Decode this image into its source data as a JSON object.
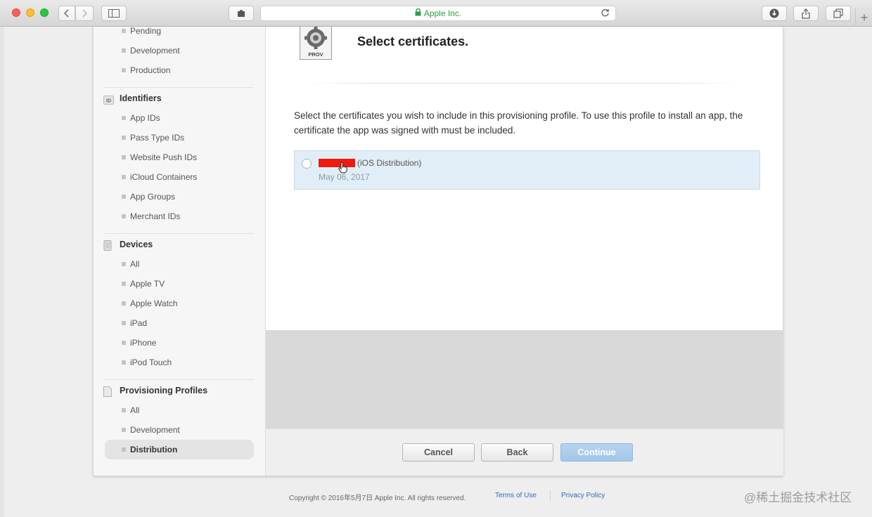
{
  "browser": {
    "url_display": "Apple Inc.",
    "new_tab_label": "+"
  },
  "sidebar": {
    "top_items": [
      "Pending",
      "Development",
      "Production"
    ],
    "sections": [
      {
        "title": "Identifiers",
        "icon": "id-icon",
        "items": [
          "App IDs",
          "Pass Type IDs",
          "Website Push IDs",
          "iCloud Containers",
          "App Groups",
          "Merchant IDs"
        ]
      },
      {
        "title": "Devices",
        "icon": "device-icon",
        "items": [
          "All",
          "Apple TV",
          "Apple Watch",
          "iPad",
          "iPhone",
          "iPod Touch"
        ]
      },
      {
        "title": "Provisioning Profiles",
        "icon": "document-icon",
        "items": [
          "All",
          "Development",
          "Distribution"
        ],
        "active": "Distribution"
      }
    ],
    "id_badge": "ID"
  },
  "main": {
    "prov_icon_label": "PROV",
    "title": "Select certificates.",
    "description": "Select the certificates you wish to include in this provisioning profile. To use this profile to install an app, the certificate the app was signed with must be included.",
    "certificates": [
      {
        "type": "(iOS Distribution)",
        "date": "May 06, 2017"
      }
    ]
  },
  "buttons": {
    "cancel": "Cancel",
    "back": "Back",
    "continue": "Continue"
  },
  "footer": {
    "copyright": "Copyright © 2016年5月7日 Apple Inc. All rights reserved.",
    "terms": "Terms of Use",
    "privacy": "Privacy Policy"
  },
  "watermark": "@稀土掘金技术社区",
  "colors": {
    "accent_blue": "#a2c6ea",
    "link_blue": "#2b6fb6",
    "secure_green": "#2aa040",
    "redaction": "#f01a0c"
  }
}
